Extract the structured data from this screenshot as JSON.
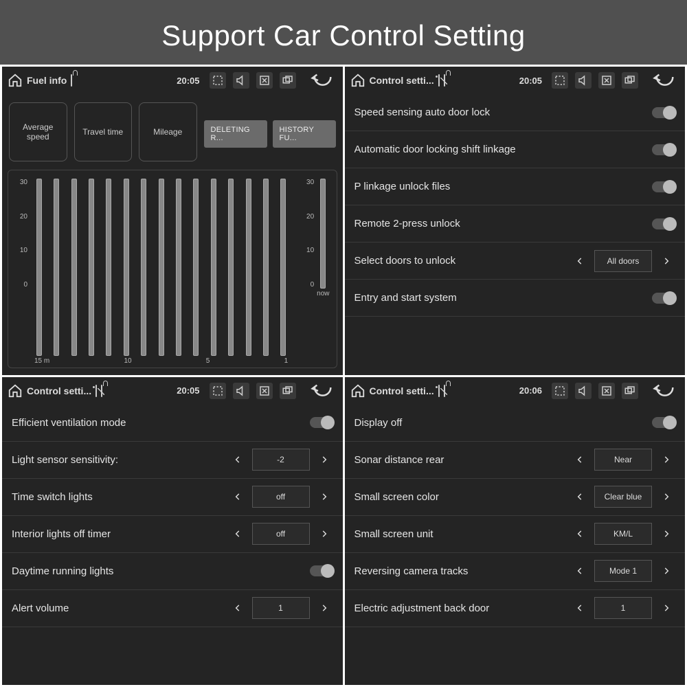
{
  "banner": "Support Car Control Setting",
  "panels": {
    "tl": {
      "header": {
        "title": "Fuel info",
        "time": "20:05"
      },
      "tiles": [
        "Average speed",
        "Travel time",
        "Mileage"
      ],
      "buttons": {
        "delete": "DELETING R...",
        "history": "HISTORY FU..."
      },
      "yticks": [
        "30",
        "20",
        "10",
        "0"
      ],
      "xlabels": [
        "15 m",
        "10",
        "5",
        "1"
      ],
      "now": "now"
    },
    "tr": {
      "header": {
        "title": "Control setti...",
        "time": "20:05"
      },
      "rows": [
        {
          "label": "Speed sensing auto door lock",
          "kind": "toggle"
        },
        {
          "label": "Automatic door locking shift linkage",
          "kind": "toggle"
        },
        {
          "label": "P linkage unlock files",
          "kind": "toggle"
        },
        {
          "label": "Remote 2-press unlock",
          "kind": "toggle"
        },
        {
          "label": "Select doors to unlock",
          "kind": "select",
          "value": "All doors"
        },
        {
          "label": "Entry and start system",
          "kind": "toggle"
        }
      ]
    },
    "bl": {
      "header": {
        "title": "Control setti...",
        "time": "20:05"
      },
      "rows": [
        {
          "label": "Efficient ventilation mode",
          "kind": "toggle"
        },
        {
          "label": "Light sensor sensitivity:",
          "kind": "select",
          "value": "-2"
        },
        {
          "label": "Time switch lights",
          "kind": "select",
          "value": "off"
        },
        {
          "label": "Interior lights off timer",
          "kind": "select",
          "value": "off"
        },
        {
          "label": "Daytime running lights",
          "kind": "toggle"
        },
        {
          "label": "Alert volume",
          "kind": "select",
          "value": "1"
        }
      ]
    },
    "br": {
      "header": {
        "title": "Control setti...",
        "time": "20:06"
      },
      "rows": [
        {
          "label": "Display off",
          "kind": "toggle"
        },
        {
          "label": "Sonar distance rear",
          "kind": "select",
          "value": "Near"
        },
        {
          "label": "Small screen color",
          "kind": "select",
          "value": "Clear blue"
        },
        {
          "label": "Small screen unit",
          "kind": "select",
          "value": "KM/L"
        },
        {
          "label": "Reversing camera tracks",
          "kind": "select",
          "value": "Mode 1"
        },
        {
          "label": "Electric adjustment back door",
          "kind": "select",
          "value": "1"
        }
      ]
    }
  }
}
